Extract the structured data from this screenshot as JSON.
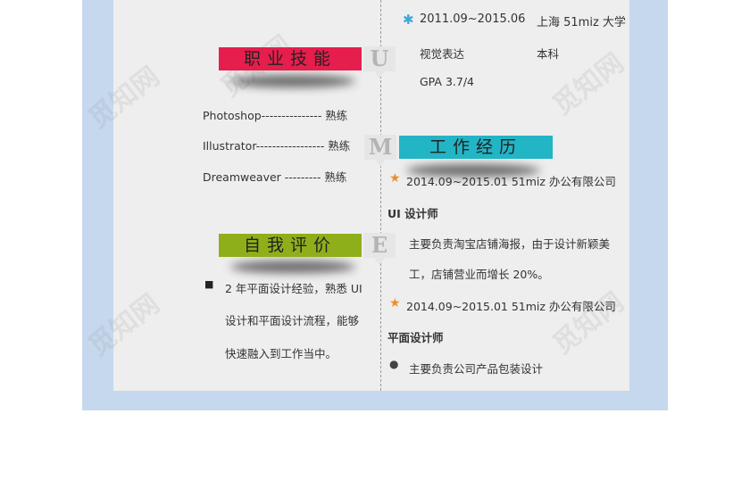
{
  "watermark": "觅知网",
  "colors": {
    "skills": "#e61e4d",
    "experience": "#22b5c5",
    "evaluation": "#8faf1a",
    "star": "#f28c28",
    "cross": "#3aa8d8"
  },
  "education": {
    "period": "2011.09~2015.06",
    "school": "上海 51miz 大学",
    "major": "视觉表达",
    "degree": "本科",
    "gpa": "GPA   3.7/4"
  },
  "sections": {
    "skills": {
      "title": "职业技能",
      "letter": "U"
    },
    "experience": {
      "title": "工作经历",
      "letter": "M"
    },
    "evaluation": {
      "title": "自我评价",
      "letter": "E"
    }
  },
  "skills": [
    {
      "label": "Photoshop--------------- 熟练"
    },
    {
      "label": "Illustrator----------------- 熟练"
    },
    {
      "label": "Dreamweaver --------- 熟练"
    }
  ],
  "evaluation": {
    "lines": [
      "2 年平面设计经验，熟悉 UI",
      "设计和平面设计流程，能够",
      "快速融入到工作当中。"
    ]
  },
  "experience": [
    {
      "header": "2014.09~2015.01 51miz 办公有限公司",
      "role": "UI 设计师",
      "lines": [
        "主要负责淘宝店铺海报，由于设计新颖美",
        "工，店铺营业而增长 20%。"
      ]
    },
    {
      "header": "2014.09~2015.01  51miz  办公有限公司",
      "role": "平面设计师",
      "lines": [
        "主要负责公司产品包装设计"
      ]
    }
  ]
}
